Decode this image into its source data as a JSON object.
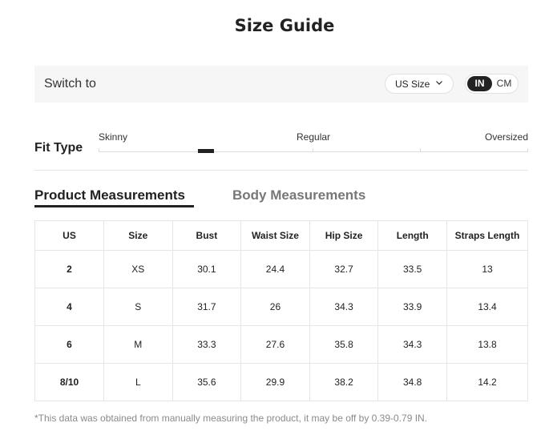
{
  "title": "Size Guide",
  "switch_bar": {
    "label": "Switch to",
    "size_select": {
      "value": "US Size",
      "icon": "chevron-down-icon"
    },
    "units": {
      "in": "IN",
      "cm": "CM",
      "selected": "IN"
    }
  },
  "fit_type": {
    "label": "Fit Type",
    "options": [
      "Skinny",
      "Regular",
      "Oversized"
    ],
    "position": 0.25
  },
  "tabs": {
    "product": "Product Measurements",
    "body": "Body Measurements",
    "active": "product"
  },
  "table": {
    "headers": [
      "US",
      "Size",
      "Bust",
      "Waist Size",
      "Hip Size",
      "Length",
      "Straps Length"
    ],
    "rows": [
      [
        "2",
        "XS",
        "30.1",
        "24.4",
        "32.7",
        "33.5",
        "13"
      ],
      [
        "4",
        "S",
        "31.7",
        "26",
        "34.3",
        "33.9",
        "13.4"
      ],
      [
        "6",
        "M",
        "33.3",
        "27.6",
        "35.8",
        "34.3",
        "13.8"
      ],
      [
        "8/10",
        "L",
        "35.6",
        "29.9",
        "38.2",
        "34.8",
        "14.2"
      ]
    ]
  },
  "footnote": "*This data was obtained from manually measuring the product, it may be off by 0.39-0.79 IN."
}
